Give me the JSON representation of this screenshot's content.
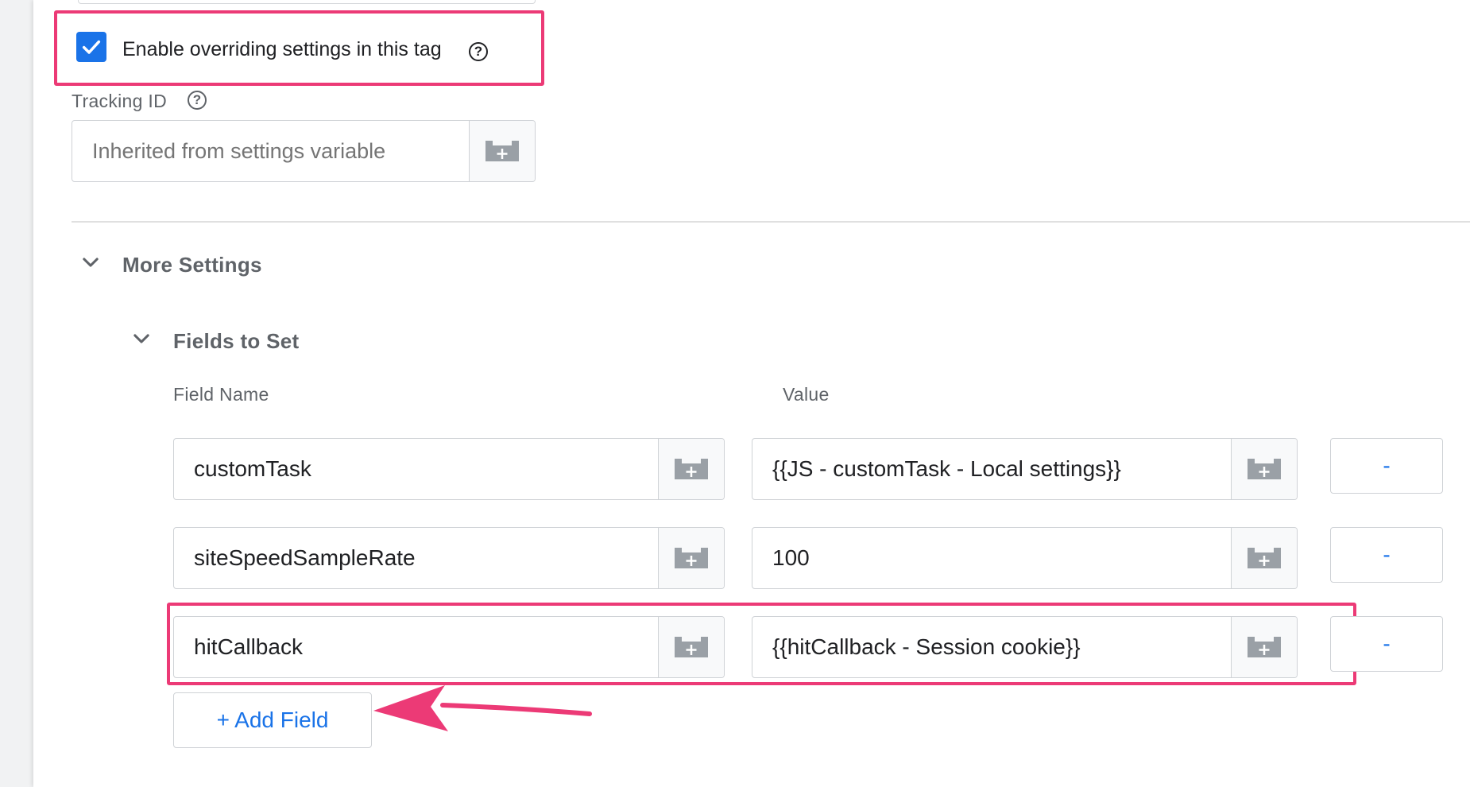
{
  "override": {
    "label": "Enable overriding settings in this tag",
    "checked": true
  },
  "tracking": {
    "label": "Tracking ID",
    "placeholder": "Inherited from settings variable"
  },
  "more_settings": {
    "title": "More Settings"
  },
  "fields_to_set": {
    "title": "Fields to Set",
    "field_name_header": "Field Name",
    "value_header": "Value",
    "rows": [
      {
        "name": "customTask",
        "value": "{{JS - customTask - Local settings}}"
      },
      {
        "name": "siteSpeedSampleRate",
        "value": "100"
      },
      {
        "name": "hitCallback",
        "value": "{{hitCallback - Session cookie}}"
      }
    ],
    "remove_label": "-",
    "add_label": "+ Add Field"
  },
  "colors": {
    "accent": "#1a73e8",
    "highlight": "#ec3a76",
    "muted_text": "#5f6368",
    "border": "#cfd2d6"
  },
  "icons": {
    "checkbox": "checkmark-icon",
    "help": "help-circle-icon",
    "variable": "variable-brick-plus-icon",
    "chevron": "chevron-down-icon",
    "arrow": "annotation-arrow"
  }
}
